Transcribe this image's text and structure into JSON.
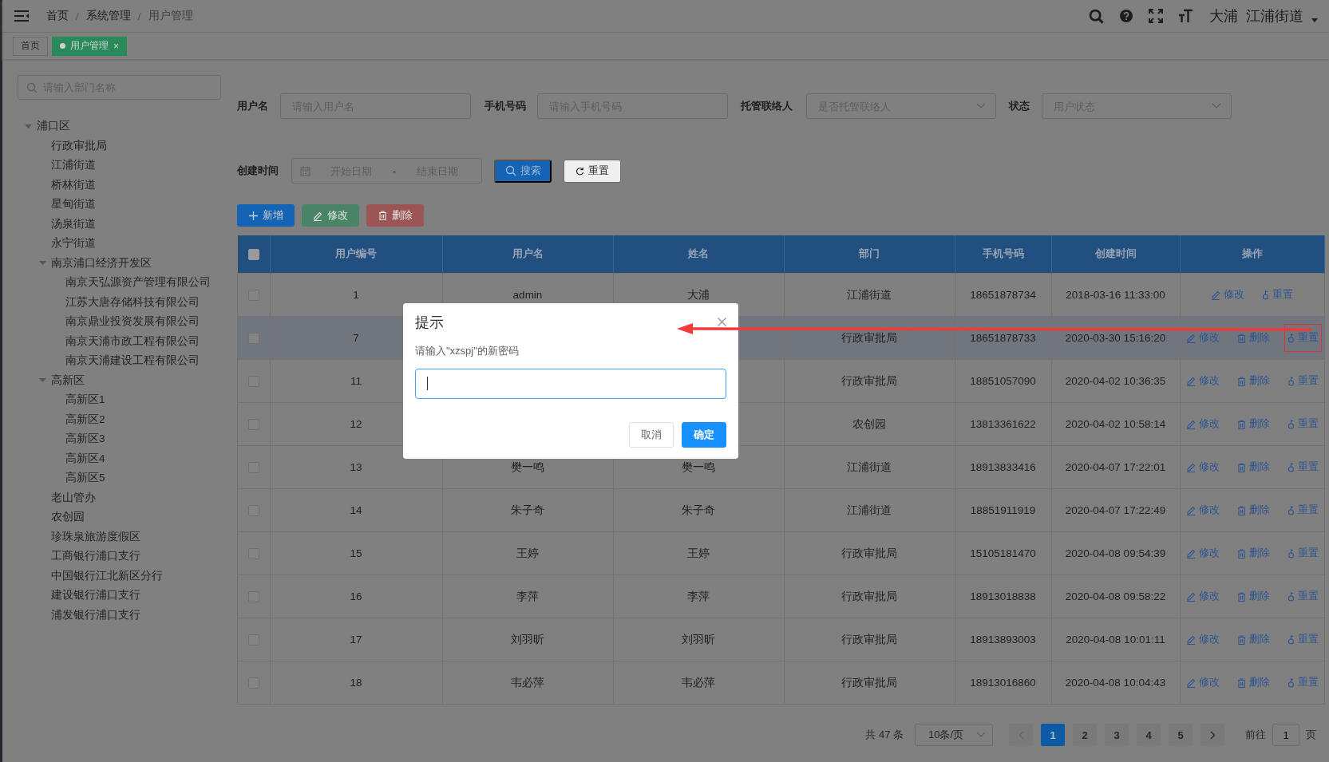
{
  "topbar": {
    "breadcrumb": [
      {
        "kind": "link",
        "text": "首页"
      },
      {
        "kind": "separator",
        "text": "/"
      },
      {
        "kind": "link",
        "text": "系统管理"
      },
      {
        "kind": "separator",
        "text": "/"
      },
      {
        "kind": "current",
        "text": "用户管理"
      }
    ],
    "user": {
      "name": "大浦",
      "dept": "江浦街道"
    }
  },
  "tags": [
    {
      "label": "首页",
      "selected": false
    },
    {
      "label": "用户管理",
      "selected": true,
      "close": "×"
    }
  ],
  "sidebar": {
    "search": {
      "placeholder": "请输入部门名称"
    },
    "tree": [
      {
        "label": "浦口区",
        "expanded": true,
        "children": [
          {
            "label": "行政审批局"
          },
          {
            "label": "江浦街道"
          },
          {
            "label": "桥林街道"
          },
          {
            "label": "星甸街道"
          },
          {
            "label": "汤泉街道"
          },
          {
            "label": "永宁街道"
          },
          {
            "label": "南京浦口经济开发区",
            "expanded": true,
            "children": [
              {
                "label": "南京天弘源资产管理有限公司"
              },
              {
                "label": "江苏大唐存储科技有限公司"
              },
              {
                "label": "南京鼎业投资发展有限公司"
              },
              {
                "label": "南京天浦市政工程有限公司"
              },
              {
                "label": "南京天浦建设工程有限公司"
              }
            ]
          },
          {
            "label": "高新区",
            "expanded": true,
            "children": [
              {
                "label": "高新区1"
              },
              {
                "label": "高新区2"
              },
              {
                "label": "高新区3"
              },
              {
                "label": "高新区4"
              },
              {
                "label": "高新区5"
              }
            ]
          },
          {
            "label": "老山管办"
          },
          {
            "label": "农创园"
          },
          {
            "label": "珍珠泉旅游度假区"
          },
          {
            "label": "工商银行浦口支行"
          },
          {
            "label": "中国银行江北新区分行"
          },
          {
            "label": "建设银行浦口支行"
          },
          {
            "label": "浦发银行浦口支行"
          }
        ]
      }
    ]
  },
  "filters": [
    {
      "kind": "input",
      "label": "用户名",
      "placeholder": "请输入用户名"
    },
    {
      "kind": "input",
      "label": "手机号码",
      "placeholder": "请输入手机号码"
    },
    {
      "kind": "select",
      "label": "托管联络人",
      "placeholder": "是否托管联络人"
    },
    {
      "kind": "select",
      "label": "状态",
      "placeholder": "用户状态"
    }
  ],
  "date_filter": {
    "label": "创建时间",
    "start_placeholder": "开始日期",
    "separator": "-",
    "end_placeholder": "结束日期"
  },
  "search_buttons": [
    {
      "kind": "search",
      "label": "搜索"
    },
    {
      "kind": "reset",
      "label": "重置"
    }
  ],
  "toolbar": [
    {
      "kind": "add",
      "label": "新增",
      "disabled": false
    },
    {
      "kind": "edit",
      "label": "修改",
      "disabled": true
    },
    {
      "kind": "delete",
      "label": "删除",
      "disabled": true
    }
  ],
  "table": {
    "select_all": {
      "checked": false
    },
    "columns": [
      "用户编号",
      "用户名",
      "姓名",
      "部门",
      "手机号码",
      "创建时间",
      "操作"
    ],
    "rows": [
      {
        "checked": false,
        "highlighted": false,
        "cells": [
          "1",
          "admin",
          "大浦",
          "江浦街道",
          "18651878734",
          "2018-03-16 11:33:00"
        ],
        "actions": [
          {
            "kind": "edit",
            "label": "修改",
            "outlined": false
          },
          {
            "kind": "reset",
            "label": "重置",
            "outlined": false
          }
        ]
      },
      {
        "checked": false,
        "highlighted": true,
        "cells": [
          "7",
          null,
          null,
          "行政审批局",
          "18651878733",
          "2020-03-30 15:16:20"
        ],
        "actions": [
          {
            "kind": "edit",
            "label": "修改",
            "outlined": false
          },
          {
            "kind": "delete",
            "label": "删除",
            "outlined": false
          },
          {
            "kind": "reset",
            "label": "重置",
            "outlined": true
          }
        ]
      },
      {
        "checked": false,
        "highlighted": false,
        "cells": [
          "11",
          null,
          null,
          "行政审批局",
          "18851057090",
          "2020-04-02 10:36:35"
        ],
        "actions": [
          {
            "kind": "edit",
            "label": "修改",
            "outlined": false
          },
          {
            "kind": "delete",
            "label": "删除",
            "outlined": false
          },
          {
            "kind": "reset",
            "label": "重置",
            "outlined": false
          }
        ]
      },
      {
        "checked": false,
        "highlighted": false,
        "cells": [
          "12",
          null,
          null,
          "农创园",
          "13813361622",
          "2020-04-02 10:58:14"
        ],
        "actions": [
          {
            "kind": "edit",
            "label": "修改",
            "outlined": false
          },
          {
            "kind": "delete",
            "label": "删除",
            "outlined": false
          },
          {
            "kind": "reset",
            "label": "重置",
            "outlined": false
          }
        ]
      },
      {
        "checked": false,
        "highlighted": false,
        "cells": [
          "13",
          "樊一鸣",
          "樊一鸣",
          "江浦街道",
          "18913833416",
          "2020-04-07 17:22:01"
        ],
        "actions": [
          {
            "kind": "edit",
            "label": "修改",
            "outlined": false
          },
          {
            "kind": "delete",
            "label": "删除",
            "outlined": false
          },
          {
            "kind": "reset",
            "label": "重置",
            "outlined": false
          }
        ]
      },
      {
        "checked": false,
        "highlighted": false,
        "cells": [
          "14",
          "朱子奇",
          "朱子奇",
          "江浦街道",
          "18851911919",
          "2020-04-07 17:22:49"
        ],
        "actions": [
          {
            "kind": "edit",
            "label": "修改",
            "outlined": false
          },
          {
            "kind": "delete",
            "label": "删除",
            "outlined": false
          },
          {
            "kind": "reset",
            "label": "重置",
            "outlined": false
          }
        ]
      },
      {
        "checked": false,
        "highlighted": false,
        "cells": [
          "15",
          "王婷",
          "王婷",
          "行政审批局",
          "15105181470",
          "2020-04-08 09:54:39"
        ],
        "actions": [
          {
            "kind": "edit",
            "label": "修改",
            "outlined": false
          },
          {
            "kind": "delete",
            "label": "删除",
            "outlined": false
          },
          {
            "kind": "reset",
            "label": "重置",
            "outlined": false
          }
        ]
      },
      {
        "checked": false,
        "highlighted": false,
        "cells": [
          "16",
          "李萍",
          "李萍",
          "行政审批局",
          "18913018838",
          "2020-04-08 09:58:22"
        ],
        "actions": [
          {
            "kind": "edit",
            "label": "修改",
            "outlined": false
          },
          {
            "kind": "delete",
            "label": "删除",
            "outlined": false
          },
          {
            "kind": "reset",
            "label": "重置",
            "outlined": false
          }
        ]
      },
      {
        "checked": false,
        "highlighted": false,
        "cells": [
          "17",
          "刘羽昕",
          "刘羽昕",
          "行政审批局",
          "18913893003",
          "2020-04-08 10:01:11"
        ],
        "actions": [
          {
            "kind": "edit",
            "label": "修改",
            "outlined": false
          },
          {
            "kind": "delete",
            "label": "删除",
            "outlined": false
          },
          {
            "kind": "reset",
            "label": "重置",
            "outlined": false
          }
        ]
      },
      {
        "checked": false,
        "highlighted": false,
        "cells": [
          "18",
          "韦必萍",
          "韦必萍",
          "行政审批局",
          "18913016860",
          "2020-04-08 10:04:43"
        ],
        "actions": [
          {
            "kind": "edit",
            "label": "修改",
            "outlined": false
          },
          {
            "kind": "delete",
            "label": "删除",
            "outlined": false
          },
          {
            "kind": "reset",
            "label": "重置",
            "outlined": false
          }
        ]
      }
    ]
  },
  "pagination": {
    "total": "共 47 条",
    "page_size": "10条/页",
    "pages": [
      {
        "label": "1",
        "selected": true
      },
      {
        "label": "2",
        "selected": false
      },
      {
        "label": "3",
        "selected": false
      },
      {
        "label": "4",
        "selected": false
      },
      {
        "label": "5",
        "selected": false
      }
    ],
    "goto_label": "前往",
    "goto_value": "1",
    "page_unit": "页"
  },
  "dialog": {
    "title": "提示",
    "message": "请输入\"xzspj\"的新密码",
    "input": {
      "focused": true
    },
    "buttons": [
      {
        "kind": "cancel",
        "label": "取消"
      },
      {
        "kind": "confirm",
        "label": "确定"
      }
    ]
  },
  "annotation": {
    "arrow": true
  }
}
